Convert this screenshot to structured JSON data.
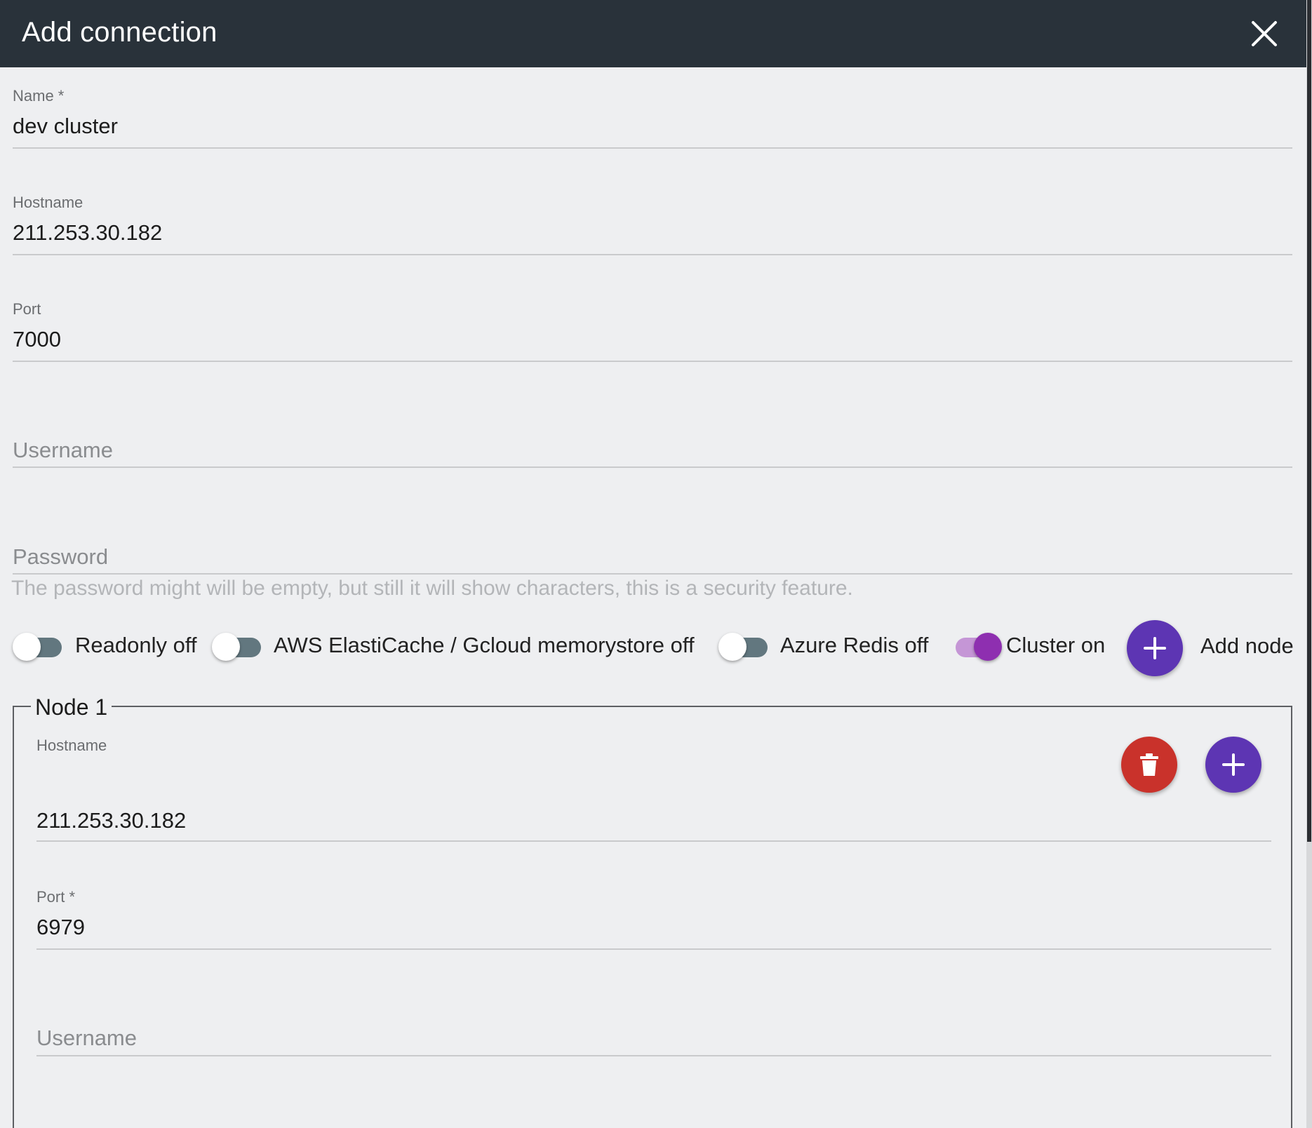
{
  "dialog": {
    "title": "Add connection",
    "close_icon": "close-icon"
  },
  "fields": {
    "name": {
      "label": "Name *",
      "value": "dev cluster"
    },
    "hostname": {
      "label": "Hostname",
      "value": "211.253.30.182"
    },
    "port": {
      "label": "Port",
      "value": "7000"
    },
    "username": {
      "placeholder": "Username"
    },
    "password": {
      "placeholder": "Password",
      "helper": "The password might will be empty, but still it will show characters, this is a security feature."
    }
  },
  "toggles": {
    "readonly": {
      "label": "Readonly off",
      "on": false
    },
    "aws": {
      "label": "AWS ElastiCache / Gcloud memorystore off",
      "on": false
    },
    "azure": {
      "label": "Azure Redis off",
      "on": false
    },
    "cluster": {
      "label": "Cluster on",
      "on": true
    }
  },
  "add_node": {
    "label": "Add node",
    "icon": "plus-icon"
  },
  "node": {
    "legend": "Node 1",
    "hostname": {
      "label": "Hostname",
      "value": "211.253.30.182"
    },
    "port": {
      "label": "Port *",
      "value": "6979"
    },
    "username": {
      "placeholder": "Username"
    },
    "delete_icon": "trash-icon",
    "add_icon": "plus-icon"
  },
  "colors": {
    "titlebar": "#29323a",
    "accent": "#5d35b3",
    "danger": "#c9322b",
    "toggle_on": "#8e2fb0"
  }
}
